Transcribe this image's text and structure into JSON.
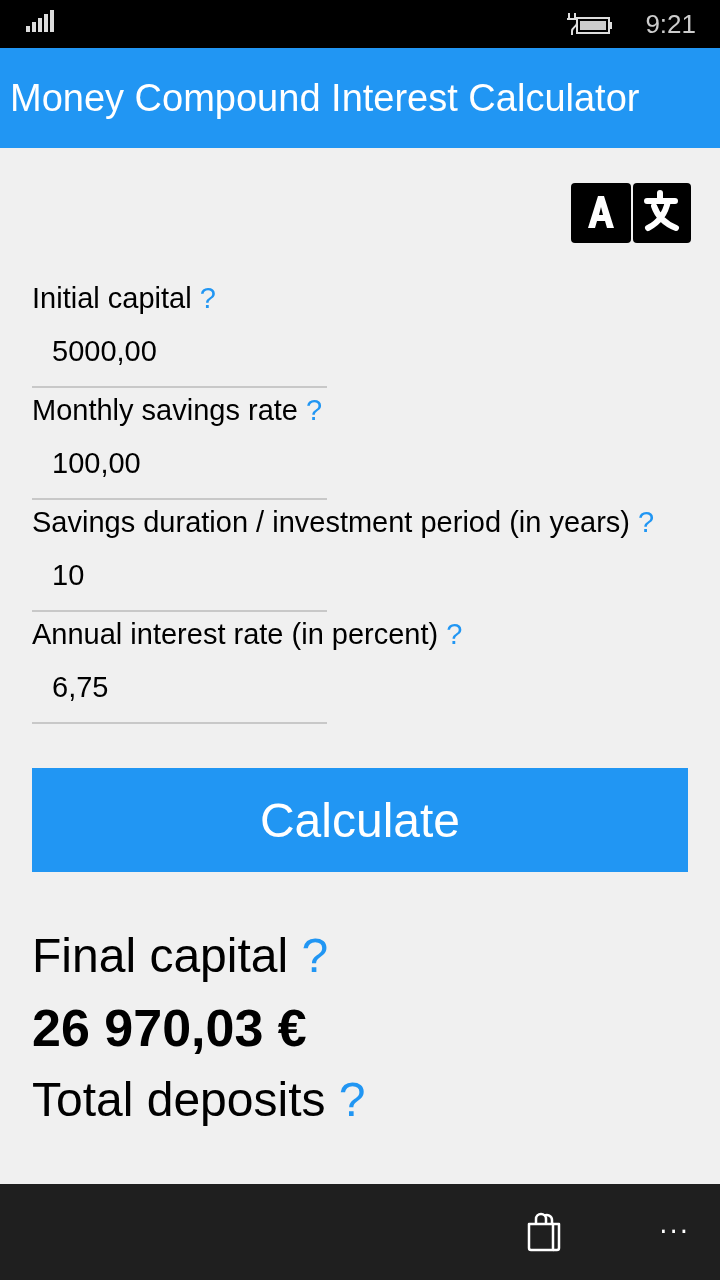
{
  "status_bar": {
    "time": "9:21",
    "charging": true
  },
  "header": {
    "title": "Money Compound Interest Calculator"
  },
  "fields": [
    {
      "label": "Initial capital",
      "help": "?",
      "value": "5000,00"
    },
    {
      "label": "Monthly savings rate",
      "help": "?",
      "value": "100,00"
    },
    {
      "label": "Savings duration / investment period (in years)",
      "help": "?",
      "value": "10"
    },
    {
      "label": "Annual interest rate (in percent)",
      "help": "?",
      "value": "6,75"
    }
  ],
  "calculate_button": "Calculate",
  "results": [
    {
      "label": "Final capital",
      "help": "?",
      "value": "26 970,03 €"
    },
    {
      "label": "Total deposits",
      "help": "?"
    }
  ],
  "app_bar": {
    "more": "···"
  }
}
